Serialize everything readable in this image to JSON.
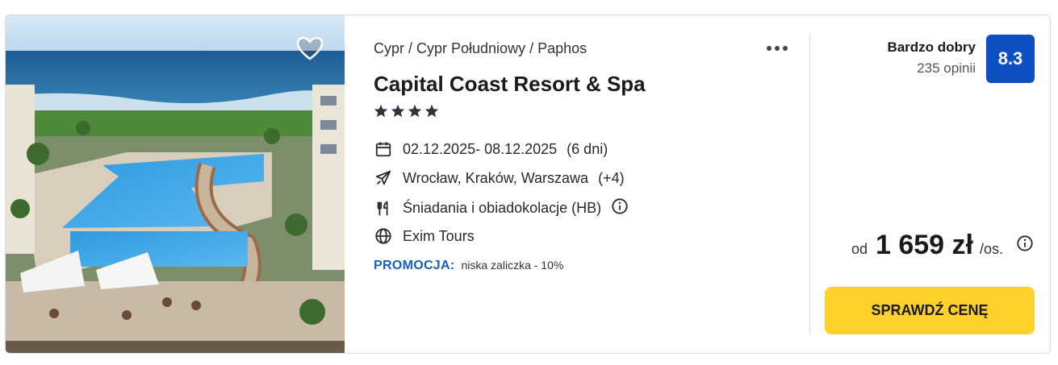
{
  "hotel": {
    "breadcrumb": "Cypr / Cypr Południowy / Paphos",
    "name": "Capital Coast Resort & Spa",
    "stars": 4,
    "dates": "02.12.2025- 08.12.2025",
    "duration": "(6 dni)",
    "departures": "Wrocław, Kraków, Warszawa",
    "departures_more": "(+4)",
    "board": "Śniadania i obiadokolacje (HB)",
    "operator": "Exim Tours"
  },
  "promo": {
    "label": "PROMOCJA:",
    "text": "niska zaliczka - 10%"
  },
  "rating": {
    "quality": "Bardzo dobry",
    "reviews": "235 opinii",
    "score": "8.3",
    "color": "#0b4fc1"
  },
  "price": {
    "prefix": "od",
    "amount": "1 659 zł",
    "suffix": "/os."
  },
  "cta": {
    "label": "SPRAWDŹ CENĘ",
    "color": "#fdd12a"
  },
  "icons": [
    "heart-icon",
    "more-icon",
    "star-icon",
    "calendar-icon",
    "plane-icon",
    "utensils-icon",
    "info-icon",
    "globe-icon"
  ]
}
